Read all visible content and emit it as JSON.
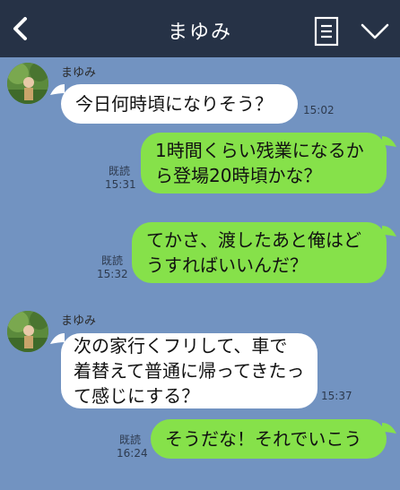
{
  "header": {
    "title": "まゆみ",
    "icons": {
      "back": "chevron-left-icon",
      "menu": "note-icon",
      "collapse": "chevron-down-icon"
    }
  },
  "messages": [
    {
      "side": "in",
      "sender": "まゆみ",
      "text": "今日何時頃になりそう？",
      "time": "15:02"
    },
    {
      "side": "out",
      "text": "1時間くらい残業になるから登場20時頃かな？",
      "read": "既読",
      "time": "15:31"
    },
    {
      "side": "out",
      "text": "てかさ、渡したあと俺はどうすればいいんだ？",
      "read": "既読",
      "time": "15:32"
    },
    {
      "side": "in",
      "sender": "まゆみ",
      "text": "次の家行くフリして、車で着替えて普通に帰ってきたって感じにする？",
      "time": "15:37"
    },
    {
      "side": "out",
      "text": "そうだな！それでいこう",
      "read": "既読",
      "time": "16:24"
    }
  ],
  "colors": {
    "background": "#7293c1",
    "header": "#263246",
    "outgoing": "#86e14a",
    "incoming": "#ffffff"
  }
}
